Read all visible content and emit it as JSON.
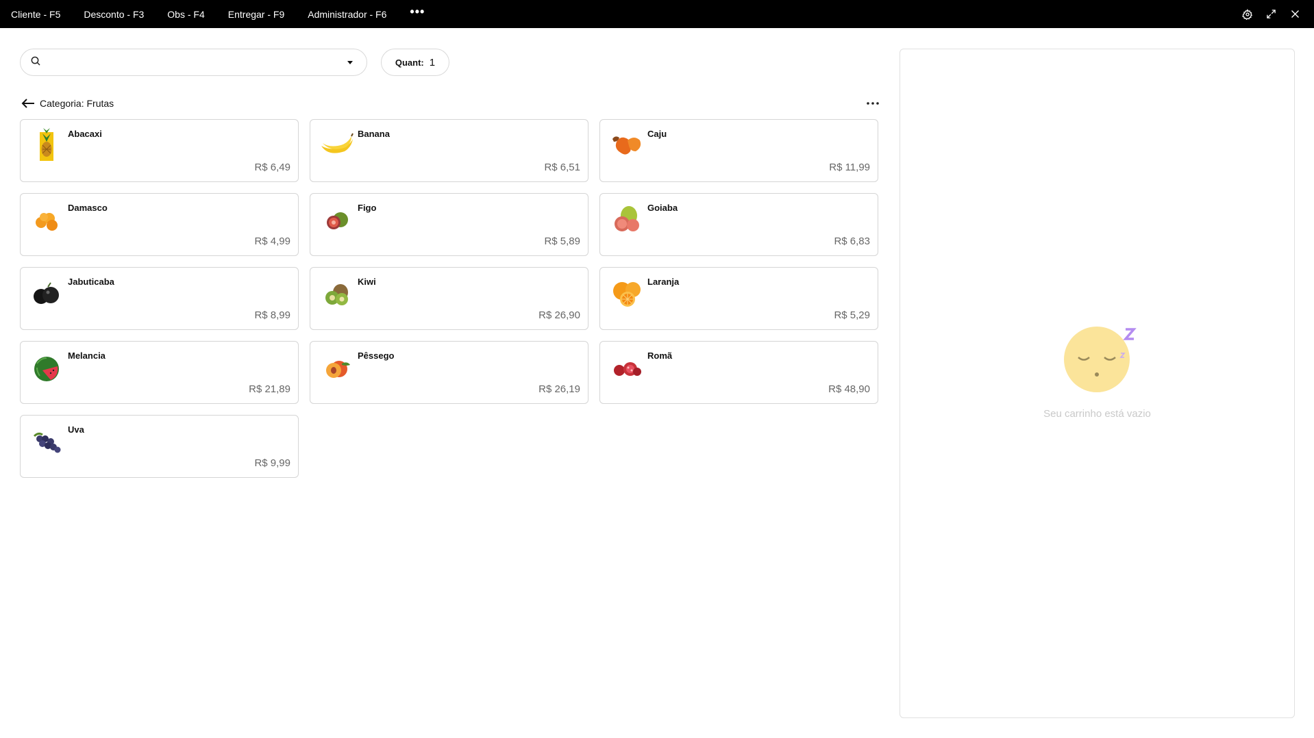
{
  "topbar": {
    "menu": [
      {
        "label": "Cliente - F5"
      },
      {
        "label": "Desconto - F3"
      },
      {
        "label": "Obs - F4"
      },
      {
        "label": "Entregar - F9"
      },
      {
        "label": "Administrador - F6"
      }
    ],
    "more_label": "•••",
    "icons": [
      "gear-icon",
      "expand-icon",
      "close-icon"
    ]
  },
  "search": {
    "value": "",
    "placeholder": ""
  },
  "quantity": {
    "label": "Quant:",
    "value": "1"
  },
  "category": {
    "title": "Categoria: Frutas"
  },
  "products": [
    {
      "name": "Abacaxi",
      "price": "R$ 6,49",
      "icon": "pineapple-icon"
    },
    {
      "name": "Banana",
      "price": "R$ 6,51",
      "icon": "banana-icon"
    },
    {
      "name": "Caju",
      "price": "R$ 11,99",
      "icon": "cashew-fruit-icon"
    },
    {
      "name": "Damasco",
      "price": "R$ 4,99",
      "icon": "apricot-icon"
    },
    {
      "name": "Figo",
      "price": "R$ 5,89",
      "icon": "fig-icon"
    },
    {
      "name": "Goiaba",
      "price": "R$ 6,83",
      "icon": "guava-icon"
    },
    {
      "name": "Jabuticaba",
      "price": "R$ 8,99",
      "icon": "jabuticaba-icon"
    },
    {
      "name": "Kiwi",
      "price": "R$ 26,90",
      "icon": "kiwi-icon"
    },
    {
      "name": "Laranja",
      "price": "R$ 5,29",
      "icon": "orange-icon"
    },
    {
      "name": "Melancia",
      "price": "R$ 21,89",
      "icon": "watermelon-icon"
    },
    {
      "name": "Pêssego",
      "price": "R$ 26,19",
      "icon": "peach-icon"
    },
    {
      "name": "Romã",
      "price": "R$ 48,90",
      "icon": "pomegranate-icon"
    },
    {
      "name": "Uva",
      "price": "R$ 9,99",
      "icon": "grapes-icon"
    }
  ],
  "cart": {
    "empty_text": "Seu carrinho está vazio",
    "empty_icon": "sleeping-face-icon"
  },
  "colors": {
    "topbar_bg": "#000000",
    "price_text": "#666666",
    "card_border": "#d5d5d5",
    "empty_face": "#fbe49a",
    "empty_z": "#b48cf0",
    "empty_text": "#c9c9c9"
  }
}
